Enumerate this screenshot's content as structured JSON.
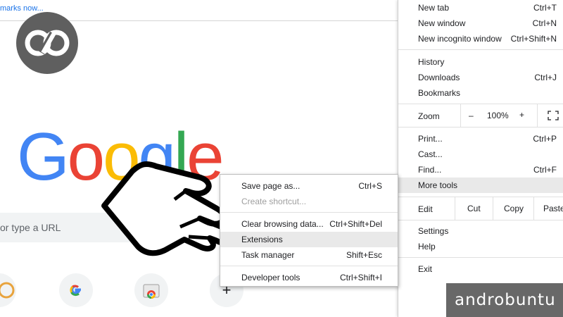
{
  "bookmarks_bar": {
    "link_text": "marks now..."
  },
  "google_logo": {
    "letters": [
      "G",
      "o",
      "o",
      "g",
      "l",
      "e"
    ],
    "colors": [
      "#4285f4",
      "#ea4335",
      "#fbbc05",
      "#4285f4",
      "#34a853",
      "#ea4335"
    ]
  },
  "search": {
    "placeholder": "or type a URL"
  },
  "shortcuts": [
    {
      "name": "shortcut-app",
      "glyph": ""
    },
    {
      "name": "shortcut-google",
      "glyph": "G"
    },
    {
      "name": "shortcut-chrome-web-store",
      "glyph": ""
    },
    {
      "name": "add-shortcut",
      "glyph": "+"
    }
  ],
  "chrome_menu": {
    "new_tab": {
      "label": "New tab",
      "shortcut": "Ctrl+T"
    },
    "new_window": {
      "label": "New window",
      "shortcut": "Ctrl+N"
    },
    "new_incognito": {
      "label": "New incognito window",
      "shortcut": "Ctrl+Shift+N"
    },
    "history": {
      "label": "History"
    },
    "downloads": {
      "label": "Downloads",
      "shortcut": "Ctrl+J"
    },
    "bookmarks": {
      "label": "Bookmarks"
    },
    "zoom": {
      "label": "Zoom",
      "minus": "–",
      "value": "100%",
      "plus": "+"
    },
    "print": {
      "label": "Print...",
      "shortcut": "Ctrl+P"
    },
    "cast": {
      "label": "Cast..."
    },
    "find": {
      "label": "Find...",
      "shortcut": "Ctrl+F"
    },
    "more_tools": {
      "label": "More tools"
    },
    "edit": {
      "label": "Edit",
      "cut": "Cut",
      "copy": "Copy",
      "paste": "Paste"
    },
    "settings": {
      "label": "Settings"
    },
    "help": {
      "label": "Help"
    },
    "exit": {
      "label": "Exit"
    }
  },
  "more_tools_submenu": {
    "save_page": {
      "label": "Save page as...",
      "shortcut": "Ctrl+S"
    },
    "create_shortcut": {
      "label": "Create shortcut..."
    },
    "clear_browsing": {
      "label": "Clear browsing data...",
      "shortcut": "Ctrl+Shift+Del"
    },
    "extensions": {
      "label": "Extensions"
    },
    "task_manager": {
      "label": "Task manager",
      "shortcut": "Shift+Esc"
    },
    "developer_tools": {
      "label": "Developer tools",
      "shortcut": "Ctrl+Shift+I"
    }
  },
  "watermark": {
    "text": "androbuntu"
  },
  "colors": {
    "highlight": "#e9e9e9",
    "watermark_bg": "#686868",
    "badge_bg": "#5f5f5f"
  }
}
